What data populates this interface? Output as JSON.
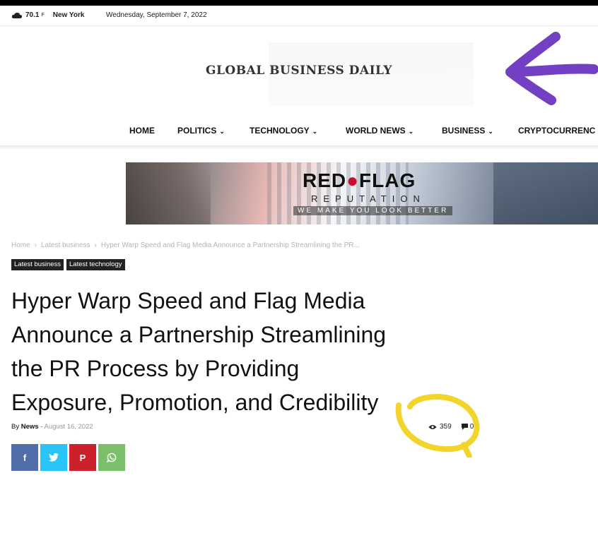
{
  "topbar": {
    "temperature": "70.1",
    "unit": "F",
    "city": "New York",
    "date": "Wednesday, September 7, 2022"
  },
  "logo": {
    "text": "GLOBAL BUSINESS DAILY"
  },
  "annotation_colors": {
    "arrow": "#7340c4",
    "highlight_circle": "#f3d42a"
  },
  "nav": {
    "items": [
      {
        "label": "HOME",
        "dropdown": false
      },
      {
        "label": "POLITICS",
        "dropdown": true
      },
      {
        "label": "TECHNOLOGY",
        "dropdown": true
      },
      {
        "label": "WORLD NEWS",
        "dropdown": true
      },
      {
        "label": "BUSINESS",
        "dropdown": true
      },
      {
        "label": "CRYPTOCURRENC",
        "dropdown": false
      }
    ]
  },
  "banner": {
    "brand_left": "RED",
    "brand_right": "FLAG",
    "brand_mid": "●",
    "sub": "REPUTATION",
    "tagline": "WE MAKE YOU LOOK BETTER"
  },
  "breadcrumb": {
    "items": [
      "Home",
      "Latest business",
      "Hyper Warp Speed and Flag Media Announce a Partnership Streamlining the PR..."
    ],
    "separator": "›"
  },
  "categories": [
    "Latest business",
    "Latest technology"
  ],
  "article": {
    "title_lines": [
      "Hyper Warp Speed and Flag Media",
      "Announce a Partnership Streamlining",
      "the PR Process by Providing",
      "Exposure, Promotion, and Credibility"
    ],
    "by": "By",
    "author": "News",
    "dash": "-",
    "date": "August 16, 2022",
    "views": "359",
    "comments": "0"
  },
  "share": {
    "facebook_icon": "f",
    "twitter_icon": "🐦",
    "pinterest_icon": "P",
    "whatsapp_icon": "☏"
  }
}
